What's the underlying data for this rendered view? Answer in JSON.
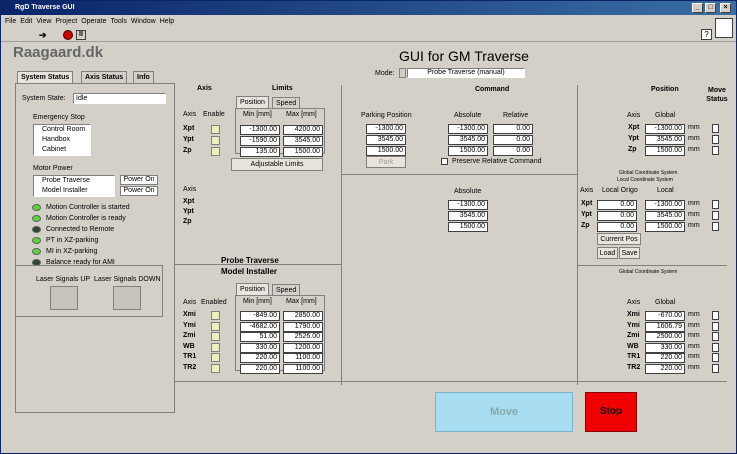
{
  "title": "RgD Traverse GUI",
  "menu": [
    "File",
    "Edit",
    "View",
    "Project",
    "Operate",
    "Tools",
    "Window",
    "Help"
  ],
  "logo": "Raagaard.dk",
  "heading": "GUI for GM Traverse",
  "mode": {
    "label": "Mode:",
    "value": "Probe Traverse (manual)"
  },
  "tabs": [
    "System Status",
    "Axis Status",
    "Info"
  ],
  "system_state": {
    "label": "System State:",
    "value": "Idle"
  },
  "emergency": {
    "title": "Emergency Stop",
    "items": [
      "Control Room",
      "Handbox",
      "Cabinet"
    ]
  },
  "motor_power": {
    "title": "Motor Power",
    "items": [
      {
        "label": "Probe Traverse",
        "status": "Power On"
      },
      {
        "label": "Model Installer",
        "status": "Power On"
      }
    ]
  },
  "leds": [
    {
      "label": "Motion Controller is started",
      "color": "#5ad43a"
    },
    {
      "label": "Motion Controller is ready",
      "color": "#5ad43a"
    },
    {
      "label": "Connected to Remote",
      "color": "#2a4a2a"
    },
    {
      "label": "PT in XZ-parking",
      "color": "#5ad43a"
    },
    {
      "label": "MI in XZ-parking",
      "color": "#5ad43a"
    },
    {
      "label": "Balance ready for AMI",
      "color": "#2a4a2a"
    }
  ],
  "laser": {
    "up": "Laser Signals UP",
    "down": "Laser Signals DOWN"
  },
  "axis_hdr": "Axis",
  "limits_hdr": "Limits",
  "enable_hdr": "Enable",
  "enabled_hdr": "Enabled",
  "subtabs": [
    "Position",
    "Speed"
  ],
  "minmax": [
    "Min [mm]",
    "Max [mm]"
  ],
  "probe_axes": [
    "Xpt",
    "Ypt",
    "Zp"
  ],
  "probe_limits": [
    [
      "-1300.00",
      "4200.00"
    ],
    [
      "-1590.00",
      "3545.00"
    ],
    [
      "135.00",
      "1500.00"
    ]
  ],
  "adjustable": "Adjustable Limits",
  "probe_axes2": [
    "Xpt",
    "Ypt",
    "Zp"
  ],
  "probe_traverse": "Probe Traverse",
  "model_installer": "Model Installer",
  "mi_axes": [
    "Xmi",
    "Ymi",
    "Zmi",
    "WB",
    "TR1",
    "TR2"
  ],
  "mi_limits": [
    [
      "-849.00",
      "2850.00"
    ],
    [
      "-4682.00",
      "1790.00"
    ],
    [
      "51.00",
      "2526.00"
    ],
    [
      "330.00",
      "1200.00"
    ],
    [
      "220.00",
      "1100.00"
    ],
    [
      "220.00",
      "1100.00"
    ]
  ],
  "parking": {
    "title": "Parking Position",
    "values": [
      "-1300.00",
      "3545.00",
      "1500.00"
    ],
    "button": "Park"
  },
  "command": {
    "title": "Command",
    "absolute": "Absolute",
    "relative": "Relative",
    "abs_values": [
      "-1300.00",
      "3545.00",
      "1500.00"
    ],
    "rel_values": [
      "0.00",
      "0.00",
      "0.00"
    ],
    "preserve": "Preserve Relative Command"
  },
  "abs2": {
    "title": "Absolute",
    "values": [
      "-1300.00",
      "3545.00",
      "1500.00"
    ]
  },
  "position": {
    "title": "Position",
    "move_status": "Move Status",
    "axis": "Axis",
    "global": "Global",
    "axes": [
      "Xpt",
      "Ypt",
      "Zp"
    ],
    "values": [
      "-1300.00",
      "3545.00",
      "1500.00"
    ],
    "unit": "mm"
  },
  "gcs": "Global Coordinate System",
  "lcs": "Local Coordinate System",
  "local": {
    "axis": "Axis",
    "origo": "Local Origo",
    "local": "Local",
    "axes": [
      "Xpt",
      "Ypt",
      "Zp"
    ],
    "origo_values": [
      "0.00",
      "0.00",
      "0.00"
    ],
    "local_values": [
      "-1300.00",
      "3545.00",
      "1500.00"
    ],
    "current_pos": "Current Pos",
    "load": "Load",
    "save": "Save"
  },
  "mi_pos": {
    "title": "Global Coordinate System",
    "axis": "Axis",
    "global": "Global",
    "axes": [
      "Xmi",
      "Ymi",
      "Zmi",
      "WB",
      "TR1",
      "TR2"
    ],
    "values": [
      "-670.00",
      "1606.79",
      "2500.00",
      "330.00",
      "220.00",
      "220.00"
    ]
  },
  "move": "Move",
  "stop": "Stop"
}
